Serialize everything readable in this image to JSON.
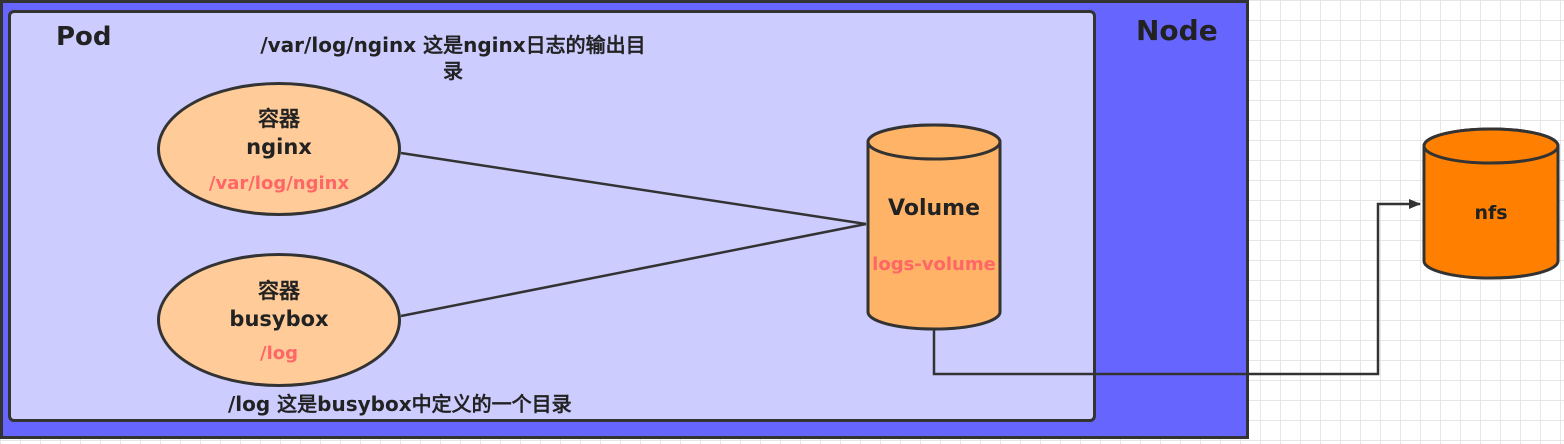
{
  "node": {
    "label": "Node",
    "fill": "#6666ff"
  },
  "pod": {
    "label": "Pod",
    "fill": "#ccccff"
  },
  "notes": {
    "nginx_dir_line1": "/var/log/nginx 这是nginx日志的输出目",
    "nginx_dir_line2": "录",
    "busybox_dir": "/log 这是busybox中定义的一个目录"
  },
  "containers": [
    {
      "title": "容器",
      "name": "nginx",
      "path": "/var/log/nginx"
    },
    {
      "title": "容器",
      "name": "busybox",
      "path": "/log"
    }
  ],
  "volume": {
    "title": "Volume",
    "name": "logs-volume",
    "fill": "#ffb366"
  },
  "nfs": {
    "title": "nfs",
    "fill": "#ff8000"
  },
  "colors": {
    "container_fill": "#ffcc99",
    "path_text": "#ff6666",
    "stroke": "#333333"
  }
}
